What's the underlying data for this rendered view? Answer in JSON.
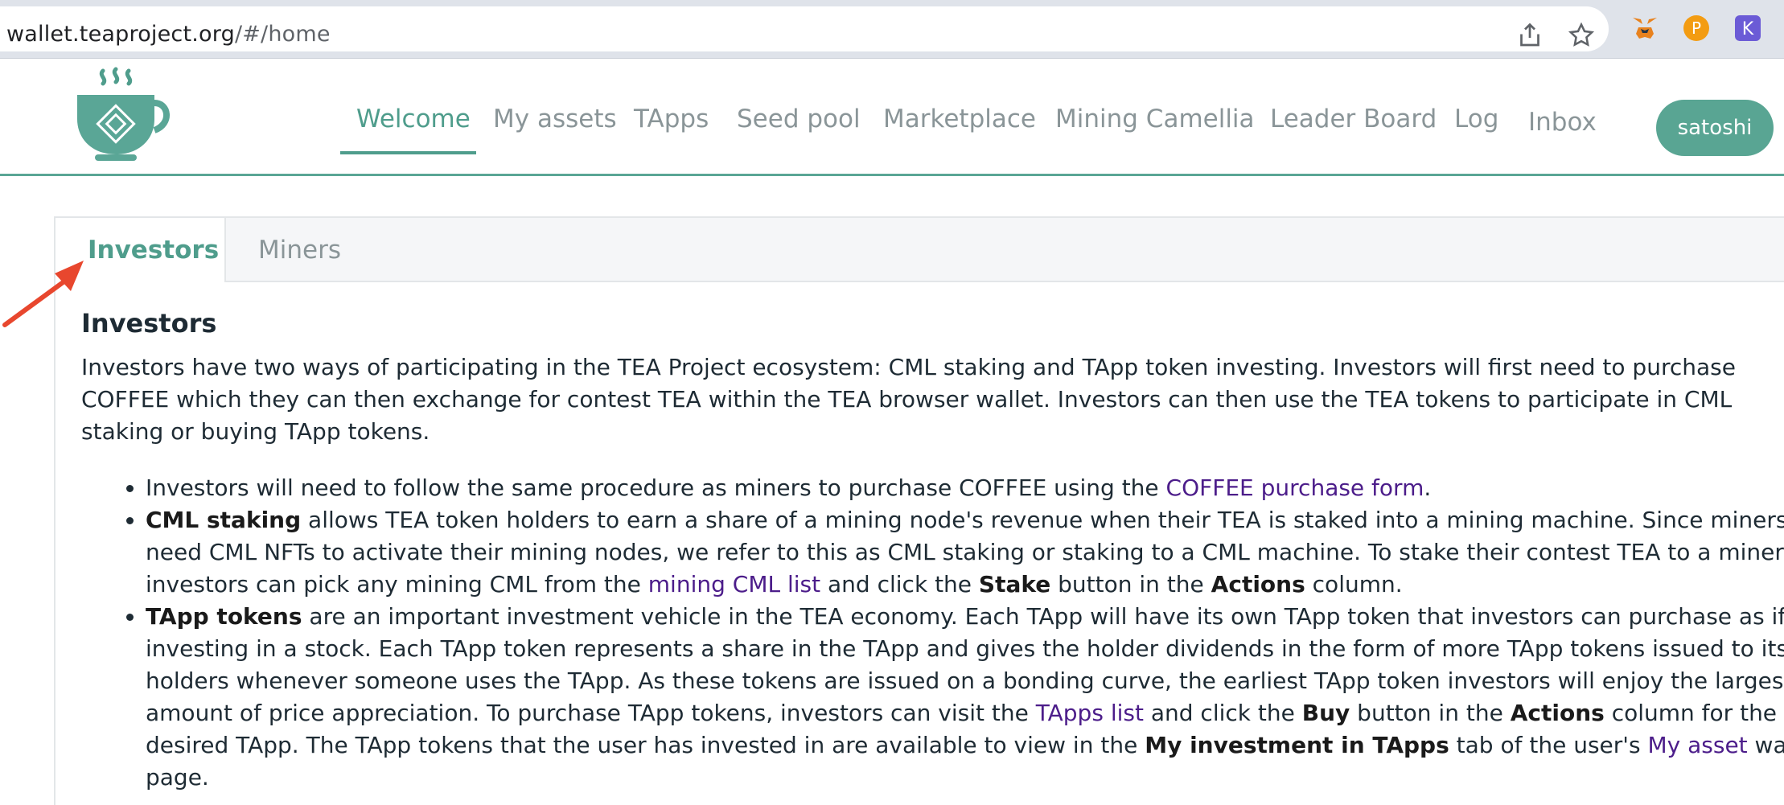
{
  "browser": {
    "url_host": "wallet.teaproject.org",
    "url_path": "/#/home"
  },
  "nav": {
    "items": [
      {
        "label": "Welcome",
        "active": true
      },
      {
        "label": "My assets"
      },
      {
        "label": "TApps"
      },
      {
        "label": "Seed pool"
      },
      {
        "label": "Marketplace"
      },
      {
        "label": "Mining Camellia"
      },
      {
        "label": "Leader Board"
      },
      {
        "label": "Log"
      },
      {
        "label": "Inbox"
      }
    ],
    "user": "satoshi"
  },
  "tabs": [
    {
      "label": "Investors",
      "active": true
    },
    {
      "label": "Miners"
    }
  ],
  "content": {
    "title": "Investors",
    "intro": "Investors have two ways of participating in the TEA Project ecosystem: CML staking and TApp token investing. Investors will first need to purchase COFFEE which they can then exchange for contest TEA within the TEA browser wallet. Investors can then use the TEA tokens to participate in CML staking or buying TApp tokens.",
    "b1_text": "Investors will need to follow the same procedure as miners to purchase COFFEE using the ",
    "b1_link": "COFFEE purchase form",
    "b1_end": ".",
    "b2_bold": "CML staking",
    "b2_text": " allows TEA token holders to earn a share of a mining node's revenue when their TEA is staked into a mining machine. Since miners need CML NFTs to activate their mining nodes, we refer to this as CML staking or staking to a CML machine. To stake their contest TEA to a miner, investors can pick any mining CML from the ",
    "b2_link": "mining CML list",
    "b2_mid": " and click the ",
    "b2_bold2": "Stake",
    "b2_mid2": " button in the ",
    "b2_bold3": "Actions",
    "b2_end": " column.",
    "b3_bold": "TApp tokens",
    "b3_text": " are an important investment vehicle in the TEA economy. Each TApp will have its own TApp token that investors can purchase as if investing in a stock. Each TApp token represents a share in the TApp and gives the holder dividends in the form of more TApp tokens issued to its holders whenever someone uses the TApp. As these tokens are issued on a bonding curve, the earliest TApp token investors will enjoy the largest amount of price appreciation. To purchase TApp tokens, investors can visit the ",
    "b3_link": "TApps list",
    "b3_mid": " and click the ",
    "b3_bold2": "Buy",
    "b3_mid2": " button in the ",
    "b3_bold3": "Actions",
    "b3_mid3": " column for the desired TApp. The TApp tokens that the user has invested in are available to view in the ",
    "b3_bold4": "My investment in TApps",
    "b3_mid4": " tab of the user's ",
    "b3_link2": "My asset",
    "b3_end": " wallet page."
  },
  "colors": {
    "accent": "#4f9d8c",
    "link": "#4c1d8a",
    "annotation_arrow": "#e8472e"
  }
}
